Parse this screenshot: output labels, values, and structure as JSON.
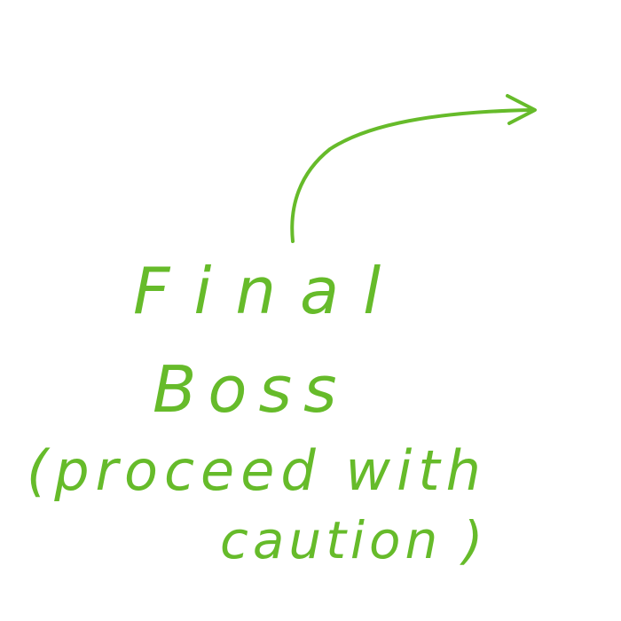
{
  "note": {
    "lines": [
      "Final",
      "Boss",
      "(proceed  with",
      "caution )"
    ]
  },
  "arrow": {
    "icon": "curved-arrow-right-icon",
    "color": "#66bb2a"
  }
}
